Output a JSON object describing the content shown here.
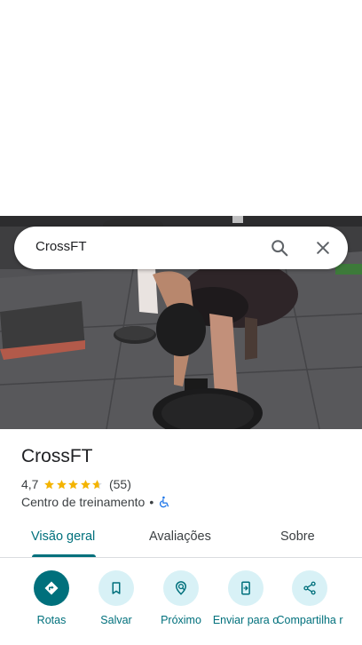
{
  "search": {
    "query": "CrossFT"
  },
  "place": {
    "title": "CrossFT",
    "rating_value": "4,7",
    "rating": 4.7,
    "reviews": "(55)",
    "category": "Centro de treinamento",
    "separator": "•"
  },
  "tabs": [
    {
      "label": "Visão geral",
      "active": true
    },
    {
      "label": "Avaliações",
      "active": false
    },
    {
      "label": "Sobre",
      "active": false
    }
  ],
  "actions": [
    {
      "label": "Rotas",
      "icon": "directions-icon"
    },
    {
      "label": "Salvar",
      "icon": "bookmark-icon"
    },
    {
      "label": "Próximo",
      "icon": "nearby-icon"
    },
    {
      "label": "Enviar para o",
      "icon": "send-to-phone-icon"
    },
    {
      "label": "Compartilha r",
      "icon": "share-icon"
    }
  ],
  "colors": {
    "accent": "#00707c",
    "action_bg": "#d8f1f6",
    "star": "#f4b400"
  }
}
